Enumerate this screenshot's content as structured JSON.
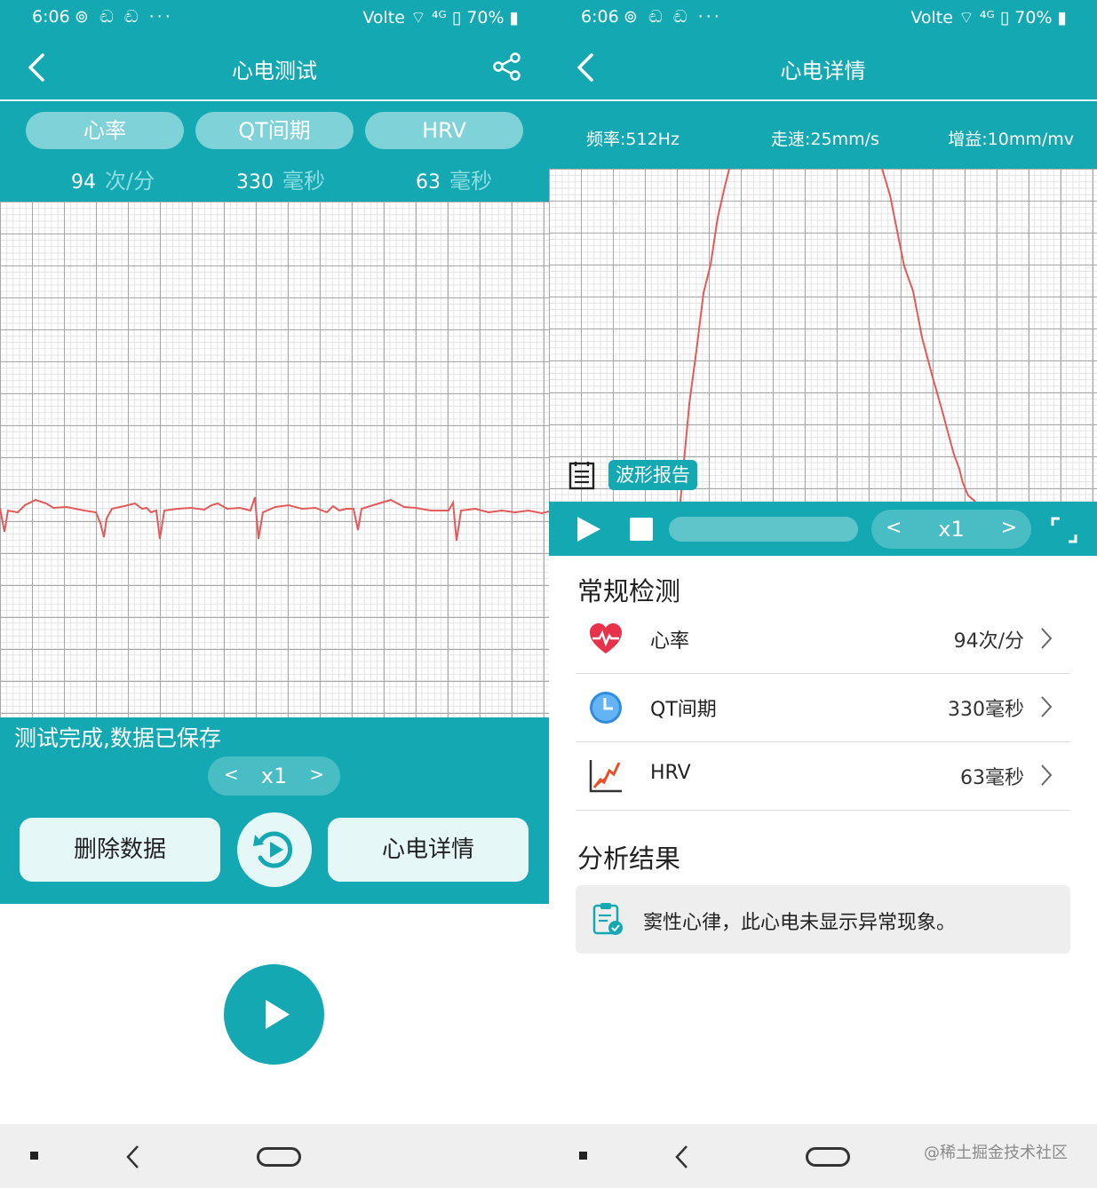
{
  "colors": {
    "primary": "#14a9b2",
    "ecg_line": "#e35a5a",
    "pill": "#7fd3d8"
  },
  "left": {
    "status": {
      "time": "6:06",
      "icons": "⊚ ඬ ඬ ···",
      "right": "Volte ⌔ ⁴ᴳ ▯ 70% ▮"
    },
    "title": "心电测试",
    "tabs": [
      {
        "label": "心率"
      },
      {
        "label": "QT间期"
      },
      {
        "label": "HRV"
      }
    ],
    "metrics": [
      {
        "value": "94",
        "unit": "次/分"
      },
      {
        "value": "330",
        "unit": "毫秒"
      },
      {
        "value": "63",
        "unit": "毫秒"
      }
    ],
    "status_message": "测试完成,数据已保存",
    "speed": {
      "prev": "<",
      "value": "x1",
      "next": ">"
    },
    "buttons": {
      "delete": "删除数据",
      "detail": "心电详情"
    }
  },
  "right": {
    "status": {
      "time": "6:06",
      "icons": "⊚ ඬ ඬ ···",
      "right": "Volte ⌔ ⁴ᴳ ▯ 70% ▮"
    },
    "title": "心电详情",
    "params": {
      "freq": "频率:512Hz",
      "speed": "走速:25mm/s",
      "gain": "增益:10mm/mv"
    },
    "report_tag": "波形报告",
    "player_speed": {
      "prev": "<",
      "value": "x1",
      "next": ">"
    },
    "routine_title": "常规检测",
    "rows": [
      {
        "label": "心率",
        "value": "94次/分",
        "icon": "heart-rate-icon"
      },
      {
        "label": "QT间期",
        "value": "330毫秒",
        "icon": "clock-icon"
      },
      {
        "label": "HRV",
        "value": "63毫秒",
        "icon": "hrv-chart-icon"
      }
    ],
    "analysis_title": "分析结果",
    "analysis_text": "窦性心律，此心电未显示异常现象。"
  },
  "watermark": "@稀土掘金技术社区"
}
